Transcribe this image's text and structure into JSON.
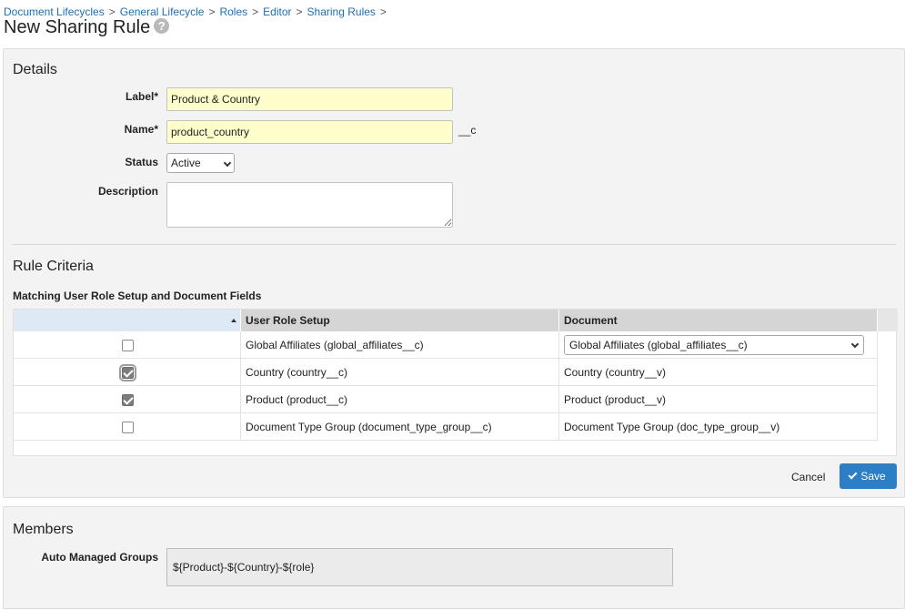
{
  "breadcrumb": [
    "Document Lifecycles",
    "General Lifecycle",
    "Roles",
    "Editor",
    "Sharing Rules"
  ],
  "breadcrumb_sep": ">",
  "page_title": "New Sharing Rule",
  "help_icon_glyph": "?",
  "details": {
    "title": "Details",
    "label_field": {
      "label": "Label*",
      "value": "Product & Country"
    },
    "name_field": {
      "label": "Name*",
      "value": "product_country",
      "suffix": "__c"
    },
    "status_field": {
      "label": "Status",
      "value": "Active"
    },
    "description_field": {
      "label": "Description",
      "value": ""
    }
  },
  "rule_criteria": {
    "title": "Rule Criteria",
    "subtitle": "Matching User Role Setup and Document Fields",
    "columns": [
      "User Role Setup",
      "Document"
    ],
    "rows": [
      {
        "checked": false,
        "focused": false,
        "user_role": "Global Affiliates (global_affiliates__c)",
        "document": "Global Affiliates (global_affiliates__c)",
        "document_is_select": true
      },
      {
        "checked": true,
        "focused": true,
        "user_role": "Country (country__c)",
        "document": "Country (country__v)",
        "document_is_select": false
      },
      {
        "checked": true,
        "focused": false,
        "user_role": "Product (product__c)",
        "document": "Product (product__v)",
        "document_is_select": false
      },
      {
        "checked": false,
        "focused": false,
        "user_role": "Document Type Group (document_type_group__c)",
        "document": "Document Type Group (doc_type_group__v)",
        "document_is_select": false
      }
    ]
  },
  "actions": {
    "cancel": "Cancel",
    "save": "Save"
  },
  "members": {
    "title": "Members",
    "auto_managed_groups": {
      "label": "Auto Managed Groups",
      "value": "${Product}-${Country}-${role}"
    }
  },
  "colors": {
    "accent": "#2c7ec5",
    "link": "#1b6fb5",
    "required_bg": "#ffffcc"
  }
}
